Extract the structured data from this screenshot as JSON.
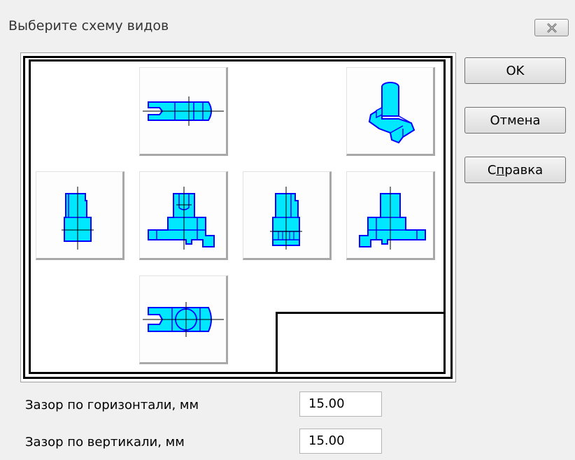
{
  "window": {
    "title": "Выберите схему видов",
    "close_icon": "close-x-icon"
  },
  "buttons": {
    "ok": "OK",
    "cancel": "Отмена",
    "help_prefix": "С",
    "help_underlined": "п",
    "help_suffix": "равка"
  },
  "views": [
    {
      "name": "top-view",
      "icon": "part-top-view-icon"
    },
    {
      "name": "isometric-view",
      "icon": "part-isometric-view-icon"
    },
    {
      "name": "right-view",
      "icon": "part-right-view-icon"
    },
    {
      "name": "front-view",
      "icon": "part-front-view-icon"
    },
    {
      "name": "left-view",
      "icon": "part-left-view-icon"
    },
    {
      "name": "rear-view",
      "icon": "part-rear-view-icon"
    },
    {
      "name": "bottom-view",
      "icon": "part-bottom-view-icon"
    }
  ],
  "fields": {
    "horizontal_gap_label": "Зазор по горизонтали, мм",
    "horizontal_gap_value": "15.00",
    "vertical_gap_label": "Зазор по вертикали, мм",
    "vertical_gap_value": "15.00"
  },
  "colors": {
    "part_fill": "#00e8ff",
    "part_stroke": "#0000ff"
  }
}
